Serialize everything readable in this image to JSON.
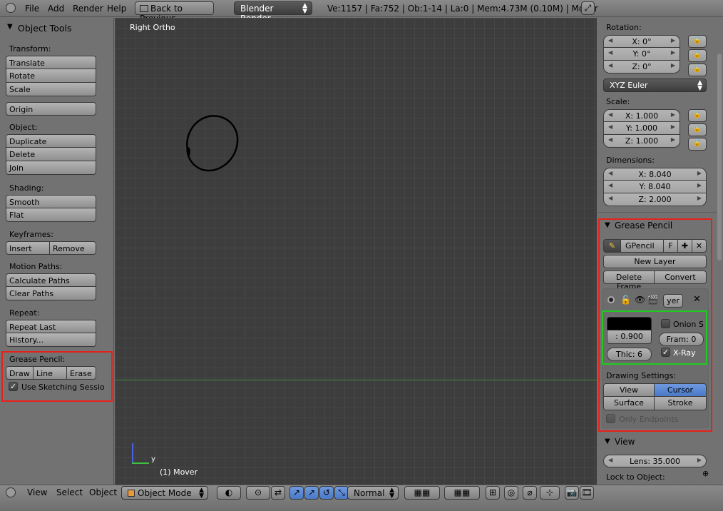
{
  "topbar": {
    "menus": [
      "File",
      "Add",
      "Render",
      "Help"
    ],
    "back_button": "Back to Previous",
    "render_engine": "Blender Render",
    "stats": "Ve:1157 | Fa:752 | Ob:1-14 | La:0 | Mem:4.73M (0.10M) | Mover"
  },
  "left": {
    "title": "Object Tools",
    "transform_label": "Transform:",
    "translate": "Translate",
    "rotate": "Rotate",
    "scale": "Scale",
    "origin": "Origin",
    "object_label": "Object:",
    "duplicate": "Duplicate",
    "delete": "Delete",
    "join": "Join",
    "shading_label": "Shading:",
    "smooth": "Smooth",
    "flat": "Flat",
    "keyframes_label": "Keyframes:",
    "insert": "Insert",
    "remove": "Remove",
    "motion_label": "Motion Paths:",
    "calc_paths": "Calculate Paths",
    "clear_paths": "Clear Paths",
    "repeat_label": "Repeat:",
    "repeat_last": "Repeat Last",
    "history": "History...",
    "gp_label": "Grease Pencil:",
    "draw": "Draw",
    "line": "Line",
    "erase": "Erase",
    "sketch": "Use Sketching Sessio"
  },
  "viewport": {
    "view_name": "Right Ortho",
    "object_name": "(1) Mover",
    "axis_y": "y"
  },
  "right": {
    "rotation_label": "Rotation:",
    "rot_x": "X: 0°",
    "rot_y": "Y: 0°",
    "rot_z": "Z: 0°",
    "rot_mode": "XYZ Euler",
    "scale_label": "Scale:",
    "scale_x": "X: 1.000",
    "scale_y": "Y: 1.000",
    "scale_z": "Z: 1.000",
    "dim_label": "Dimensions:",
    "dim_x": "X: 8.040",
    "dim_y": "Y: 8.040",
    "dim_z": "Z: 2.000",
    "gp_title": "Grease Pencil",
    "gp_name": "GPencil",
    "gp_f": "F",
    "new_layer": "New Layer",
    "delete_frame": "Delete Frame",
    "convert": "Convert",
    "layer_name": "yer",
    "opacity": ": 0.900",
    "onion": "Onion S",
    "frames": "Fram: 0",
    "thickness": "Thic: 6",
    "xray": "X-Ray",
    "drawing_settings": "Drawing Settings:",
    "view_btn": "View",
    "cursor_btn": "Cursor",
    "surface_btn": "Surface",
    "stroke_btn": "Stroke",
    "only_endpoints": "Only Endpoints",
    "view_title": "View",
    "lens": "Lens: 35.000",
    "lock_object": "Lock to Object:"
  },
  "bottombar": {
    "menus": [
      "View",
      "Select",
      "Object"
    ],
    "mode": "Object Mode",
    "pivot": "Normal"
  },
  "colors": {
    "highlight_red": "#e8201a",
    "highlight_green": "#22c922",
    "active_blue": "#5a86d2",
    "viewport_bg": "#3d3d3d"
  }
}
